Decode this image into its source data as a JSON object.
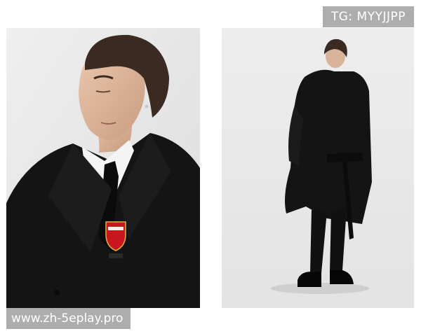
{
  "watermarks": {
    "top_right": "TG: MYYJJPP",
    "bottom_left": "www.zh-5eplay.pro"
  },
  "colors": {
    "page_background": "#ffffff",
    "studio_backdrop": "#ecebec",
    "coat": "#141414",
    "shirt": "#f4f4f4",
    "badge_red": "#c8161c",
    "watermark_background": "#969696"
  },
  "images": [
    {
      "name": "portrait-close-up",
      "subject": "man with swept-back hair in black coat, white shirt and black tie, club crest badge on chest"
    },
    {
      "name": "portrait-full-length",
      "subject": "man standing in long black trench coat, black suit and black shoes"
    }
  ]
}
